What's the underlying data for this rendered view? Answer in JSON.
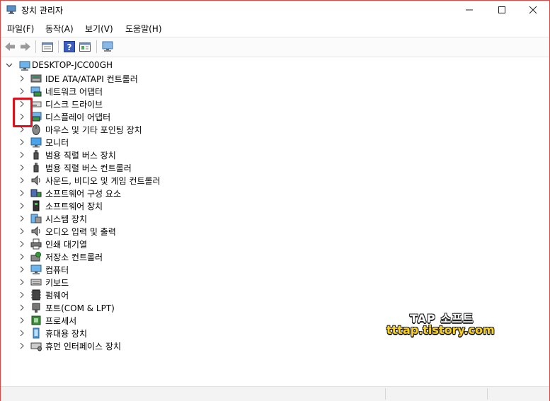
{
  "window": {
    "title": "장치 관리자"
  },
  "menu": [
    "파일(F)",
    "동작(A)",
    "보기(V)",
    "도움말(H)"
  ],
  "toolbar": [
    "back-icon",
    "forward-icon",
    "properties-icon",
    "help-icon",
    "view-icon",
    "monitor-icon"
  ],
  "tree": {
    "root": "DESKTOP-JCC00GH",
    "items": [
      {
        "label": "IDE ATA/ATAPI 컨트롤러",
        "icon": "ide-controller-icon"
      },
      {
        "label": "네트워크 어댑터",
        "icon": "network-adapter-icon"
      },
      {
        "label": "디스크 드라이브",
        "icon": "disk-drive-icon"
      },
      {
        "label": "디스플레이 어댑터",
        "icon": "display-adapter-icon"
      },
      {
        "label": "마우스 및 기타 포인팅 장치",
        "icon": "mouse-icon"
      },
      {
        "label": "모니터",
        "icon": "monitor-icon"
      },
      {
        "label": "범용 직렬 버스 장치",
        "icon": "usb-icon"
      },
      {
        "label": "범용 직렬 버스 컨트롤러",
        "icon": "usb-controller-icon"
      },
      {
        "label": "사운드, 비디오 및 게임 컨트롤러",
        "icon": "speaker-icon"
      },
      {
        "label": "소프트웨어 구성 요소",
        "icon": "software-component-icon"
      },
      {
        "label": "소프트웨어 장치",
        "icon": "software-device-icon"
      },
      {
        "label": "시스템 장치",
        "icon": "system-device-icon"
      },
      {
        "label": "오디오 입력 및 출력",
        "icon": "audio-io-icon"
      },
      {
        "label": "인쇄 대기열",
        "icon": "printer-icon"
      },
      {
        "label": "저장소 컨트롤러",
        "icon": "storage-controller-icon"
      },
      {
        "label": "컴퓨터",
        "icon": "computer-icon"
      },
      {
        "label": "키보드",
        "icon": "keyboard-icon"
      },
      {
        "label": "펌웨어",
        "icon": "firmware-icon"
      },
      {
        "label": "포트(COM & LPT)",
        "icon": "port-icon"
      },
      {
        "label": "프로세서",
        "icon": "processor-icon"
      },
      {
        "label": "휴대용 장치",
        "icon": "portable-device-icon"
      },
      {
        "label": "휴먼 인터페이스 장치",
        "icon": "hid-icon"
      }
    ]
  },
  "watermark": {
    "line1": "TAP 소프트",
    "line2": "tttap.tistory.com"
  },
  "colors": {
    "window_border": "#e0443e",
    "highlight": "#e0101a",
    "watermark_yellow": "#ffd21a"
  }
}
